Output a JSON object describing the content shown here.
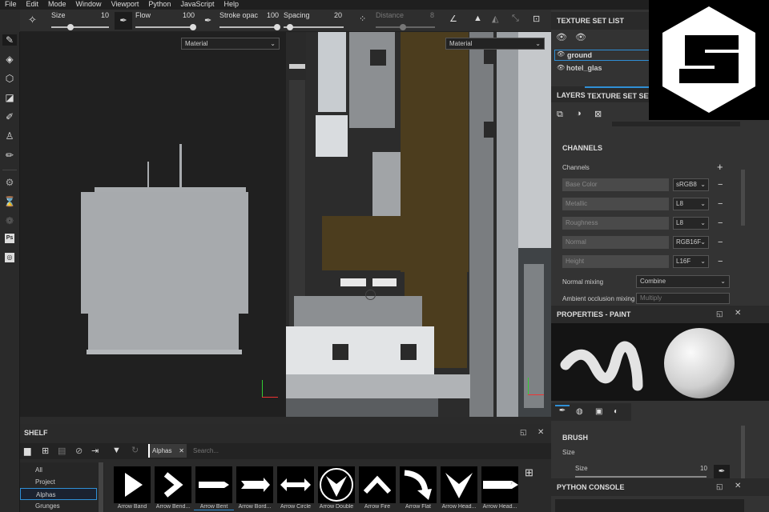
{
  "menu": [
    "File",
    "Edit",
    "Mode",
    "Window",
    "Viewport",
    "Python",
    "JavaScript",
    "Help"
  ],
  "toolbar": {
    "size_label": "Size",
    "size_value": "10",
    "flow_label": "Flow",
    "flow_value": "100",
    "stroke_label": "Stroke opac",
    "stroke_value": "100",
    "spacing_label": "Spacing",
    "spacing_value": "20",
    "distance_label": "Distance",
    "distance_value": "8"
  },
  "viewport": {
    "material_left": "Material",
    "material_right": "Material"
  },
  "texture_set": {
    "title": "TEXTURE SET LIST",
    "items": [
      "ground",
      "hotel_glas"
    ]
  },
  "tabs": {
    "layers": "LAYERS",
    "settings": "TEXTURE SET SETT"
  },
  "channels": {
    "title": "CHANNELS",
    "label": "Channels",
    "rows": [
      {
        "name": "Base Color",
        "fmt": "sRGB8"
      },
      {
        "name": "Metallic",
        "fmt": "L8"
      },
      {
        "name": "Roughness",
        "fmt": "L8"
      },
      {
        "name": "Normal",
        "fmt": "RGB16F"
      },
      {
        "name": "Height",
        "fmt": "L16F"
      }
    ],
    "normal_mixing_label": "Normal mixing",
    "normal_mixing_value": "Combine",
    "ao_mixing_label": "Ambient occlusion mixing",
    "ao_mixing_value": "Multiply"
  },
  "properties": {
    "title": "PROPERTIES - PAINT",
    "brush_title": "BRUSH",
    "size_label": "Size",
    "size_sub_label": "Size",
    "size_value": "10"
  },
  "python_console": {
    "title": "PYTHON CONSOLE"
  },
  "shelf": {
    "title": "SHELF",
    "categories": [
      "All",
      "Project",
      "Alphas",
      "Grunges"
    ],
    "selected_category": "Alphas",
    "filter_tag": "Alphas",
    "search_placeholder": "Search...",
    "items": [
      "Arrow Band",
      "Arrow Bend...",
      "Arrow Bent",
      "Arrow Bord...",
      "Arrow Circle",
      "Arrow Double",
      "Arrow Fire",
      "Arrow Flat",
      "Arrow Head...",
      "Arrow Head..."
    ]
  },
  "colors": {
    "accent": "#2f8fd6",
    "brown": "#4c3d1e"
  }
}
